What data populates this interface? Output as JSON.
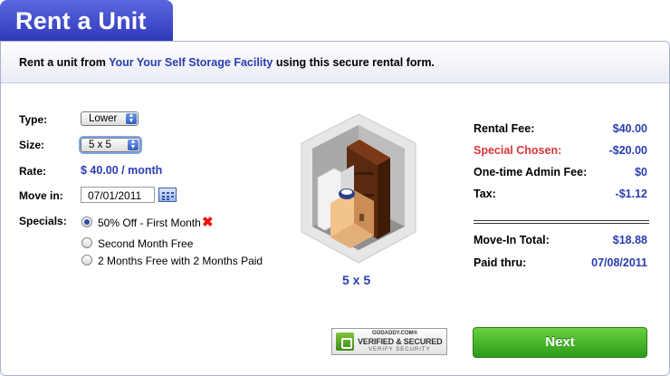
{
  "header": {
    "title": "Rent a Unit"
  },
  "intro": {
    "prefix": "Rent a unit from ",
    "facility": "Your Your Self Storage Facility",
    "suffix": " using this secure rental form."
  },
  "form": {
    "type_label": "Type:",
    "type_value": "Lower",
    "size_label": "Size:",
    "size_value": "5 x 5",
    "rate_label": "Rate:",
    "rate_value": "$ 40.00 / month",
    "movein_label": "Move in:",
    "movein_value": "07/01/2011",
    "specials_label": "Specials:",
    "specials": [
      {
        "label": "50% Off - First Month",
        "selected": true
      },
      {
        "label": "Second Month Free",
        "selected": false
      },
      {
        "label": "2 Months Free with 2 Months Paid",
        "selected": false
      }
    ]
  },
  "unit": {
    "caption": "5 x 5"
  },
  "summary": {
    "rental_fee_label": "Rental Fee:",
    "rental_fee_value": "$40.00",
    "special_label": "Special Chosen:",
    "special_value": "-$20.00",
    "admin_label": "One-time Admin Fee:",
    "admin_value": "$0",
    "tax_label": "Tax:",
    "tax_value": "-$1.12",
    "total_label": "Move-In Total:",
    "total_value": "$18.88",
    "paid_label": "Paid thru:",
    "paid_value": "07/08/2011"
  },
  "badge": {
    "line1": "GODADDY.COM®",
    "line2": "VERIFIED & SECURED",
    "line3": "VERIFY SECURITY"
  },
  "actions": {
    "next_label": "Next"
  },
  "colors": {
    "accent": "#2a3db3",
    "tab": "#3a44c4",
    "special": "#d8343a",
    "next": "#3fae26"
  }
}
